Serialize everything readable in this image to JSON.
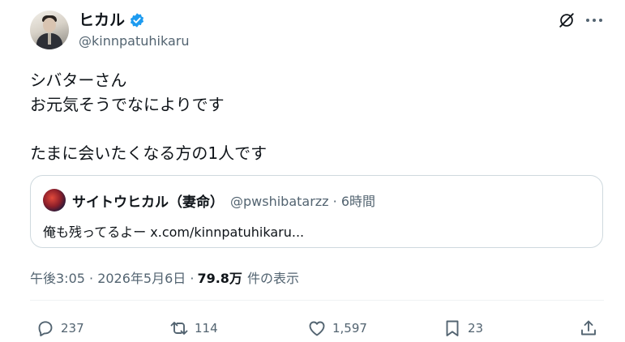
{
  "author": {
    "display_name": "ヒカル",
    "handle": "@kinnpatuhikaru",
    "verified_color": "#1d9bf0"
  },
  "tweet": {
    "lines": [
      "シバターさん",
      "お元気そうでなによりです",
      "",
      "たまに会いたくなる方の1人です"
    ]
  },
  "quote": {
    "display_name": "サイトウヒカル（妻命）",
    "meta": "@pwshibatarzz · 6時間",
    "text": "俺も残ってるよー x.com/kinnpatuhikaru..."
  },
  "timestamp": {
    "text": "午後3:05 · 2026年5月6日 ·",
    "views": "79.8万",
    "views_label": "件の表示"
  },
  "actions": {
    "reply_count": "237",
    "repost_count": "114",
    "like_count": "1,597",
    "bookmark_count": "23"
  },
  "icons": [
    "grok-icon",
    "more-icon",
    "verified-badge-icon",
    "reply-icon",
    "repost-icon",
    "like-icon",
    "bookmark-icon",
    "share-icon"
  ],
  "colors": {
    "text": "#0f1419",
    "secondary": "#536471",
    "border": "#cfd9de",
    "accent": "#1d9bf0"
  }
}
